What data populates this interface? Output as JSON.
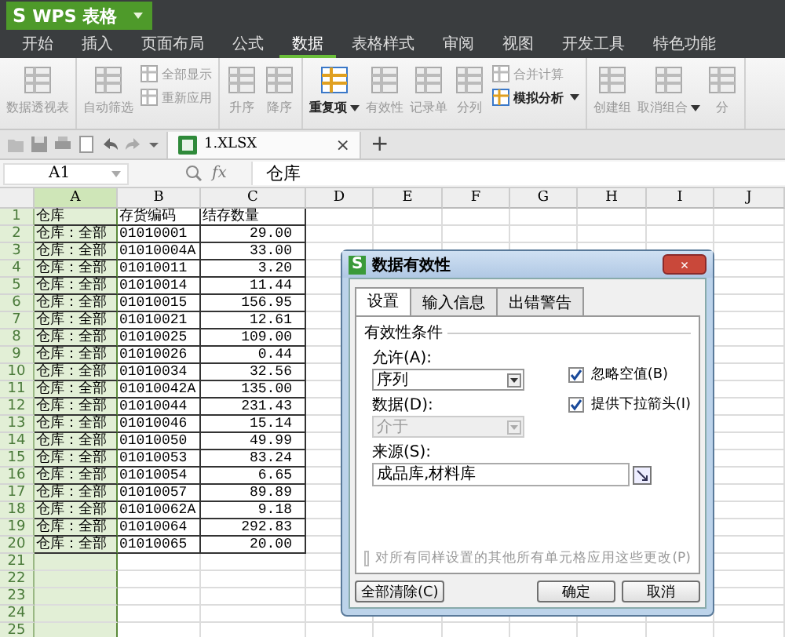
{
  "app": {
    "logo": "S",
    "title": "WPS 表格"
  },
  "menu": [
    {
      "label": "开始",
      "selected": false
    },
    {
      "label": "插入",
      "selected": false
    },
    {
      "label": "页面布局",
      "selected": false
    },
    {
      "label": "公式",
      "selected": false
    },
    {
      "label": "数据",
      "selected": true
    },
    {
      "label": "表格样式",
      "selected": false
    },
    {
      "label": "审阅",
      "selected": false
    },
    {
      "label": "视图",
      "selected": false
    },
    {
      "label": "开发工具",
      "selected": false
    },
    {
      "label": "特色功能",
      "selected": false
    }
  ],
  "ribbon": [
    {
      "items": [
        {
          "kind": "large",
          "label": "数据透视表",
          "disabled": true,
          "dropdown": false
        }
      ]
    },
    {
      "items": [
        {
          "kind": "large",
          "label": "自动筛选",
          "disabled": true,
          "dropdown": false
        },
        {
          "kind": "stack",
          "items": [
            {
              "label": "全部显示",
              "disabled": true,
              "dropdown": false
            },
            {
              "label": "重新应用",
              "disabled": true,
              "dropdown": false
            }
          ]
        }
      ]
    },
    {
      "items": [
        {
          "kind": "large",
          "label": "升序",
          "disabled": true,
          "dropdown": false
        },
        {
          "kind": "large",
          "label": "降序",
          "disabled": true,
          "dropdown": false
        }
      ]
    },
    {
      "items": [
        {
          "kind": "large",
          "label": "重复项",
          "disabled": false,
          "dropdown": true
        },
        {
          "kind": "large",
          "label": "有效性",
          "disabled": true,
          "dropdown": false
        },
        {
          "kind": "large",
          "label": "记录单",
          "disabled": true,
          "dropdown": false
        },
        {
          "kind": "large",
          "label": "分列",
          "disabled": true,
          "dropdown": false
        },
        {
          "kind": "stack",
          "items": [
            {
              "label": "合并计算",
              "disabled": true,
              "dropdown": false
            },
            {
              "label": "模拟分析",
              "disabled": false,
              "dropdown": true
            }
          ]
        }
      ]
    },
    {
      "items": [
        {
          "kind": "large",
          "label": "创建组",
          "disabled": true,
          "dropdown": false
        },
        {
          "kind": "large",
          "label": "取消组合",
          "disabled": true,
          "dropdown": true
        },
        {
          "kind": "large",
          "label": "分",
          "disabled": true,
          "dropdown": false
        }
      ]
    }
  ],
  "doc_tab": {
    "name": "1.XLSX",
    "close": "×",
    "new_tab": "+"
  },
  "formula_bar": {
    "name_box": "A1",
    "fx": "fx",
    "content": "仓库"
  },
  "columns": [
    {
      "label": "A",
      "selected": true
    },
    {
      "label": "B",
      "selected": false
    },
    {
      "label": "C",
      "selected": false
    },
    {
      "label": "D",
      "selected": false
    },
    {
      "label": "E",
      "selected": false
    },
    {
      "label": "F",
      "selected": false
    },
    {
      "label": "G",
      "selected": false
    },
    {
      "label": "H",
      "selected": false
    },
    {
      "label": "I",
      "selected": false
    },
    {
      "label": "J",
      "selected": false
    }
  ],
  "rows": [
    {
      "number": "1",
      "cells": [
        "仓库",
        "存货编码",
        "结存数量"
      ]
    },
    {
      "number": "2",
      "cells": [
        "仓库：全部",
        "01010001",
        "29.00"
      ]
    },
    {
      "number": "3",
      "cells": [
        "仓库：全部",
        "01010004A",
        "33.00"
      ]
    },
    {
      "number": "4",
      "cells": [
        "仓库：全部",
        "01010011",
        "3.20"
      ]
    },
    {
      "number": "5",
      "cells": [
        "仓库：全部",
        "01010014",
        "11.44"
      ]
    },
    {
      "number": "6",
      "cells": [
        "仓库：全部",
        "01010015",
        "156.95"
      ]
    },
    {
      "number": "7",
      "cells": [
        "仓库：全部",
        "01010021",
        "12.61"
      ]
    },
    {
      "number": "8",
      "cells": [
        "仓库：全部",
        "01010025",
        "109.00"
      ]
    },
    {
      "number": "9",
      "cells": [
        "仓库：全部",
        "01010026",
        "0.44"
      ]
    },
    {
      "number": "10",
      "cells": [
        "仓库：全部",
        "01010034",
        "32.56"
      ]
    },
    {
      "number": "11",
      "cells": [
        "仓库：全部",
        "01010042A",
        "135.00"
      ]
    },
    {
      "number": "12",
      "cells": [
        "仓库：全部",
        "01010044",
        "231.43"
      ]
    },
    {
      "number": "13",
      "cells": [
        "仓库：全部",
        "01010046",
        "15.14"
      ]
    },
    {
      "number": "14",
      "cells": [
        "仓库：全部",
        "01010050",
        "49.99"
      ]
    },
    {
      "number": "15",
      "cells": [
        "仓库：全部",
        "01010053",
        "83.24"
      ]
    },
    {
      "number": "16",
      "cells": [
        "仓库：全部",
        "01010054",
        "6.65"
      ]
    },
    {
      "number": "17",
      "cells": [
        "仓库：全部",
        "01010057",
        "89.89"
      ]
    },
    {
      "number": "18",
      "cells": [
        "仓库：全部",
        "01010062A",
        "9.18"
      ]
    },
    {
      "number": "19",
      "cells": [
        "仓库：全部",
        "01010064",
        "292.83"
      ]
    },
    {
      "number": "20",
      "cells": [
        "仓库：全部",
        "01010065",
        "20.00"
      ]
    },
    {
      "number": "21",
      "cells": []
    },
    {
      "number": "22",
      "cells": []
    },
    {
      "number": "23",
      "cells": []
    },
    {
      "number": "24",
      "cells": []
    },
    {
      "number": "25",
      "cells": []
    }
  ],
  "dialog": {
    "logo": "S",
    "title": "数据有效性",
    "close": "×",
    "tabs": [
      {
        "label": "设置",
        "selected": true
      },
      {
        "label": "输入信息",
        "selected": false
      },
      {
        "label": "出错警告",
        "selected": false
      }
    ],
    "group": "有效性条件",
    "allow": {
      "label": "允许(A):",
      "value": "序列",
      "disabled": false
    },
    "data": {
      "label": "数据(D):",
      "value": "介于",
      "disabled": true
    },
    "checkboxes": [
      {
        "label": "忽略空值(B)",
        "checked": true
      },
      {
        "label": "提供下拉箭头(I)",
        "checked": true
      }
    ],
    "source": {
      "label": "来源(S):",
      "value": "成品库,材料库"
    },
    "apply_all": {
      "label": "对所有同样设置的其他所有单元格应用这些更改(P)",
      "checked": false,
      "disabled": true
    },
    "buttons": [
      {
        "label": "全部清除(C)"
      },
      {
        "label": "确定"
      },
      {
        "label": "取消"
      }
    ]
  }
}
